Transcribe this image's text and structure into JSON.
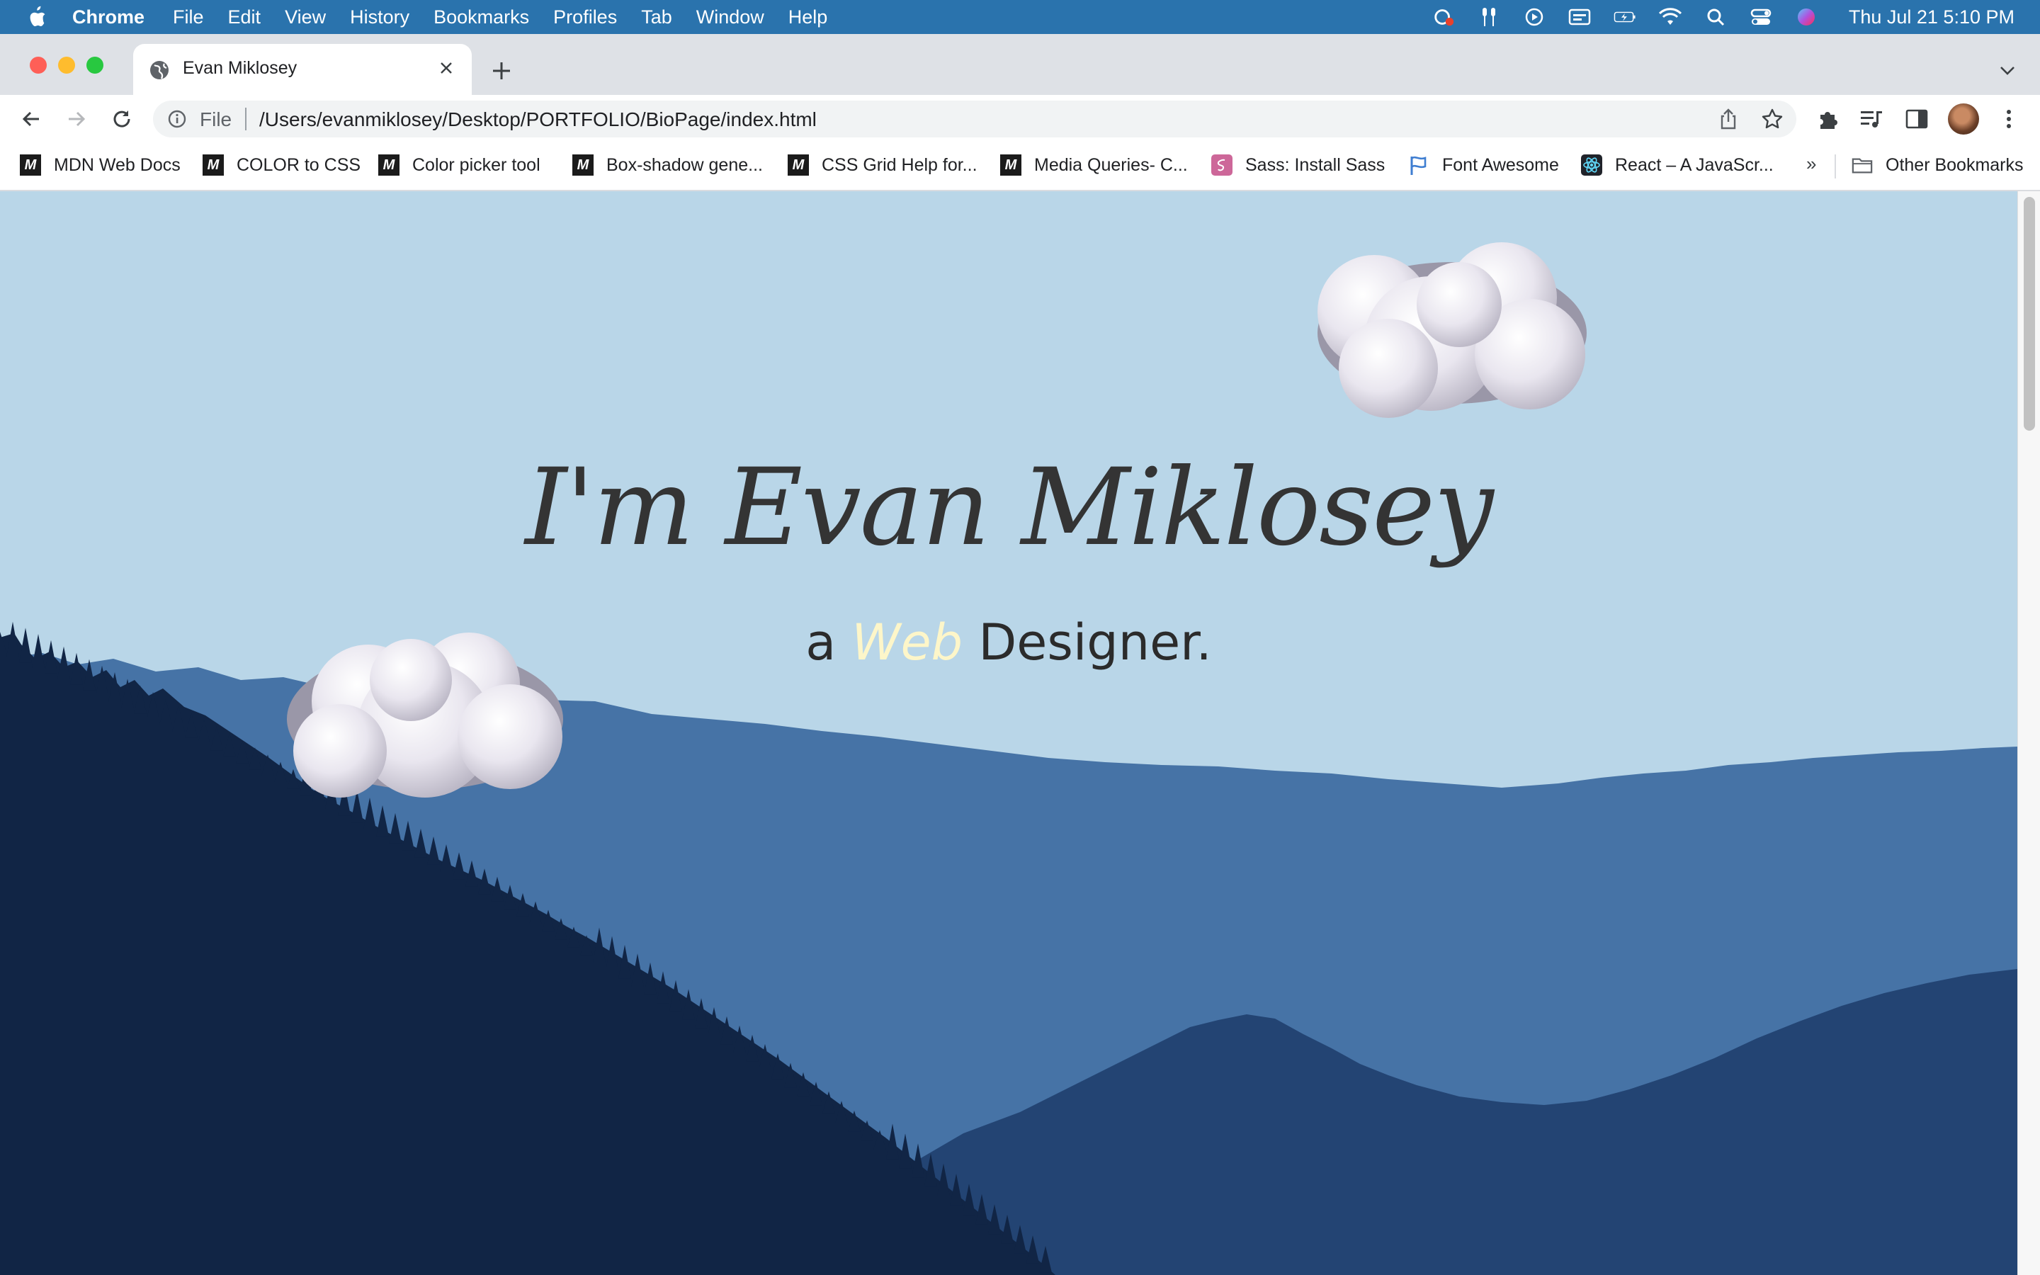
{
  "menubar": {
    "app": "Chrome",
    "items": [
      "File",
      "Edit",
      "View",
      "History",
      "Bookmarks",
      "Profiles",
      "Tab",
      "Window",
      "Help"
    ],
    "clock": "Thu Jul 21  5:10 PM"
  },
  "tab": {
    "title": "Evan Miklosey"
  },
  "address": {
    "scheme": "File",
    "url": "/Users/evanmiklosey/Desktop/PORTFOLIO/BioPage/index.html"
  },
  "bookmarks": [
    {
      "label": "MDN Web Docs",
      "icon": "mdn"
    },
    {
      "label": "COLOR to CSS",
      "icon": "mdn"
    },
    {
      "label": "Color picker tool",
      "icon": "mdn"
    },
    {
      "label": "Box-shadow gene...",
      "icon": "mdn"
    },
    {
      "label": "CSS Grid Help for...",
      "icon": "mdn"
    },
    {
      "label": "Media Queries- C...",
      "icon": "mdn"
    },
    {
      "label": "Sass: Install Sass",
      "icon": "sass"
    },
    {
      "label": "Font Awesome",
      "icon": "flag"
    },
    {
      "label": "React – A JavaScr...",
      "icon": "react"
    }
  ],
  "bookmarks_more": "»",
  "other_bookmarks": "Other Bookmarks",
  "hero": {
    "name": "I'm Evan Miklosey",
    "tag_prefix": "a",
    "tag_accent": "Web",
    "tag_suffix": "Designer."
  },
  "colors": {
    "sky": "#b9d6e8",
    "far_hills": "#4673a6",
    "mid_hills": "#234473",
    "near_hills": "#112545",
    "accent_text": "#fdf6c9"
  }
}
